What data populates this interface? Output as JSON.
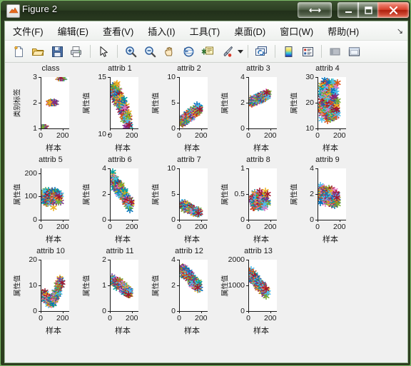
{
  "window": {
    "title": "Figure 2",
    "icon": "matlab-figure-icon",
    "controls": [
      {
        "name": "resize-button",
        "glyph": "↔"
      },
      {
        "name": "minimize-button",
        "glyph": "–"
      },
      {
        "name": "maximize-button",
        "glyph": "❐"
      },
      {
        "name": "close-button",
        "glyph": "✕"
      }
    ]
  },
  "menubar": {
    "items": [
      {
        "name": "menu-file",
        "label": "文件(F)"
      },
      {
        "name": "menu-edit",
        "label": "编辑(E)"
      },
      {
        "name": "menu-view",
        "label": "查看(V)"
      },
      {
        "name": "menu-insert",
        "label": "插入(I)"
      },
      {
        "name": "menu-tools",
        "label": "工具(T)"
      },
      {
        "name": "menu-desktop",
        "label": "桌面(D)"
      },
      {
        "name": "menu-window",
        "label": "窗口(W)"
      },
      {
        "name": "menu-help",
        "label": "帮助(H)"
      }
    ],
    "overflow_glyph": "↘"
  },
  "toolbar": {
    "buttons": [
      "new-figure-icon",
      "open-file-icon",
      "save-figure-icon",
      "print-figure-icon",
      "sep",
      "pointer-icon",
      "sep",
      "zoom-in-icon",
      "zoom-out-icon",
      "pan-icon",
      "rotate-3d-icon",
      "data-cursor-icon",
      "brush-icon",
      "caret",
      "sep",
      "link-plot-icon",
      "sep",
      "colorbar-icon",
      "legend-icon",
      "sep",
      "hide-plot-tools-icon",
      "show-plot-tools-icon"
    ]
  },
  "chart_data": {
    "type": "scatter",
    "layout": {
      "rows": 3,
      "cols": 5,
      "total_panels": 14,
      "grid": false,
      "legend_position": "none"
    },
    "shared": {
      "xlabel": "样本",
      "xticks": [
        0,
        200
      ],
      "xlim": [
        0,
        260
      ],
      "marker": "asterisk",
      "marker_colors": [
        "#0072bd",
        "#d95319",
        "#edb120",
        "#7e2f8e",
        "#77ac30",
        "#4dbeee",
        "#a2142f",
        "#00a0a0",
        "#e377c2"
      ]
    },
    "panels": [
      {
        "index": 0,
        "title": "class",
        "ylabel": "类别标签",
        "yticks": [
          1,
          2,
          3
        ],
        "ylim": [
          1,
          3
        ],
        "point_count": 178,
        "clusters": [
          {
            "y": 1,
            "n": 59
          },
          {
            "y": 2,
            "n": 71
          },
          {
            "y": 3,
            "n": 48
          }
        ],
        "shape": "three-discrete-bands"
      },
      {
        "index": 1,
        "title": "attrib 1",
        "ylabel": "属性值",
        "yticks": [
          10,
          15
        ],
        "ylim": [
          10.5,
          15
        ],
        "point_count": 178,
        "value_range": [
          11.0,
          14.9
        ],
        "shape": "vertical-cloud-tapering-down"
      },
      {
        "index": 2,
        "title": "attrib 2",
        "ylabel": "属性值",
        "yticks": [
          0,
          5,
          10
        ],
        "ylim": [
          0,
          10
        ],
        "point_count": 178,
        "value_range": [
          0.7,
          5.8
        ],
        "shape": "low-band-rising-right"
      },
      {
        "index": 3,
        "title": "attrib 3",
        "ylabel": "属性值",
        "yticks": [
          0,
          2,
          4
        ],
        "ylim": [
          0,
          4
        ],
        "point_count": 178,
        "value_range": [
          1.3,
          3.2
        ],
        "shape": "mid-band-compact"
      },
      {
        "index": 4,
        "title": "attrib 4",
        "ylabel": "属性值",
        "yticks": [
          10,
          20,
          30
        ],
        "ylim": [
          10,
          30
        ],
        "point_count": 178,
        "value_range": [
          10.6,
          30.0
        ],
        "shape": "tall-vertical-cloud"
      },
      {
        "index": 5,
        "title": "attrib 5",
        "ylabel": "属性值",
        "yticks": [
          0,
          100,
          200
        ],
        "ylim": [
          0,
          220
        ],
        "point_count": 178,
        "value_range": [
          70,
          162
        ],
        "shape": "compact-blob-near-100"
      },
      {
        "index": 6,
        "title": "attrib 6",
        "ylabel": "属性值",
        "yticks": [
          0,
          2,
          4
        ],
        "ylim": [
          0,
          4
        ],
        "point_count": 178,
        "value_range": [
          0.9,
          3.9
        ],
        "shape": "descending-diagonal-band"
      },
      {
        "index": 7,
        "title": "attrib 7",
        "ylabel": "属性值",
        "yticks": [
          0,
          5,
          10
        ],
        "ylim": [
          0,
          10
        ],
        "point_count": 178,
        "value_range": [
          0.3,
          5.1
        ],
        "shape": "descending-low-band"
      },
      {
        "index": 8,
        "title": "attrib 8",
        "ylabel": "属性值",
        "yticks": [
          0,
          0.5,
          1
        ],
        "ylim": [
          0,
          1
        ],
        "point_count": 178,
        "value_range": [
          0.13,
          0.66
        ],
        "shape": "oval-blob-center"
      },
      {
        "index": 9,
        "title": "attrib 9",
        "ylabel": "属性值",
        "yticks": [
          0,
          2,
          4
        ],
        "ylim": [
          0,
          4
        ],
        "point_count": 178,
        "value_range": [
          0.4,
          3.6
        ],
        "shape": "vertical-cloud-mid"
      },
      {
        "index": 10,
        "title": "attrib 10",
        "ylabel": "属性值",
        "yticks": [
          0,
          10,
          20
        ],
        "ylim": [
          0,
          20
        ],
        "point_count": 178,
        "value_range": [
          1.3,
          13.0
        ],
        "shape": "u-shaped-band"
      },
      {
        "index": 11,
        "title": "attrib 11",
        "ylabel": "属性值",
        "yticks": [
          0,
          1,
          2
        ],
        "ylim": [
          0,
          2
        ],
        "point_count": 178,
        "value_range": [
          0.48,
          1.71
        ],
        "shape": "descending-band-near-1"
      },
      {
        "index": 12,
        "title": "attrib 12",
        "ylabel": "属性值",
        "yticks": [
          0,
          2,
          4
        ],
        "ylim": [
          0,
          4
        ],
        "point_count": 178,
        "value_range": [
          1.27,
          4.0
        ],
        "shape": "descending-from-high"
      },
      {
        "index": 13,
        "title": "attrib 13",
        "ylabel": "属性值",
        "yticks": [
          0,
          1000,
          2000
        ],
        "ylim": [
          0,
          2000
        ],
        "point_count": 178,
        "value_range": [
          278,
          1680
        ],
        "shape": "descending-wide-band"
      }
    ]
  }
}
